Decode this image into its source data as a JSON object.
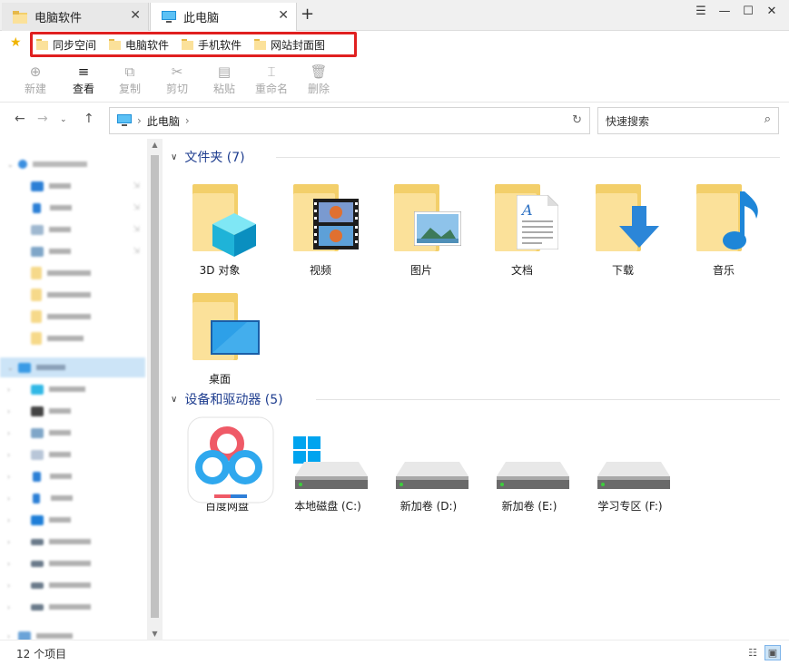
{
  "tabs": [
    {
      "label": "电脑软件",
      "icon": "folder-icon"
    },
    {
      "label": "此电脑",
      "icon": "computer-icon"
    }
  ],
  "window_controls": [
    "☰",
    "—",
    "☐",
    "✕"
  ],
  "favorites": [
    "同步空间",
    "电脑软件",
    "手机软件",
    "网站封面图"
  ],
  "toolbar": {
    "new": "新建",
    "view": "查看",
    "copy": "复制",
    "cut": "剪切",
    "paste": "粘贴",
    "rename": "重命名",
    "delete": "删除"
  },
  "address": {
    "path": "此电脑",
    "search_placeholder": "快速搜索"
  },
  "groups": {
    "folders": "文件夹 (7)",
    "drives": "设备和驱动器 (5)"
  },
  "folders": [
    "3D 对象",
    "视频",
    "图片",
    "文档",
    "下载",
    "音乐",
    "桌面"
  ],
  "drives": [
    "百度网盘",
    "本地磁盘 (C:)",
    "新加卷 (D:)",
    "新加卷 (E:)",
    "学习专区 (F:)"
  ],
  "status": {
    "count": "12 个项目"
  },
  "colors": {
    "accent": "#1e3d8f",
    "highlight_box": "#e02020",
    "selection": "#cce4f7"
  }
}
